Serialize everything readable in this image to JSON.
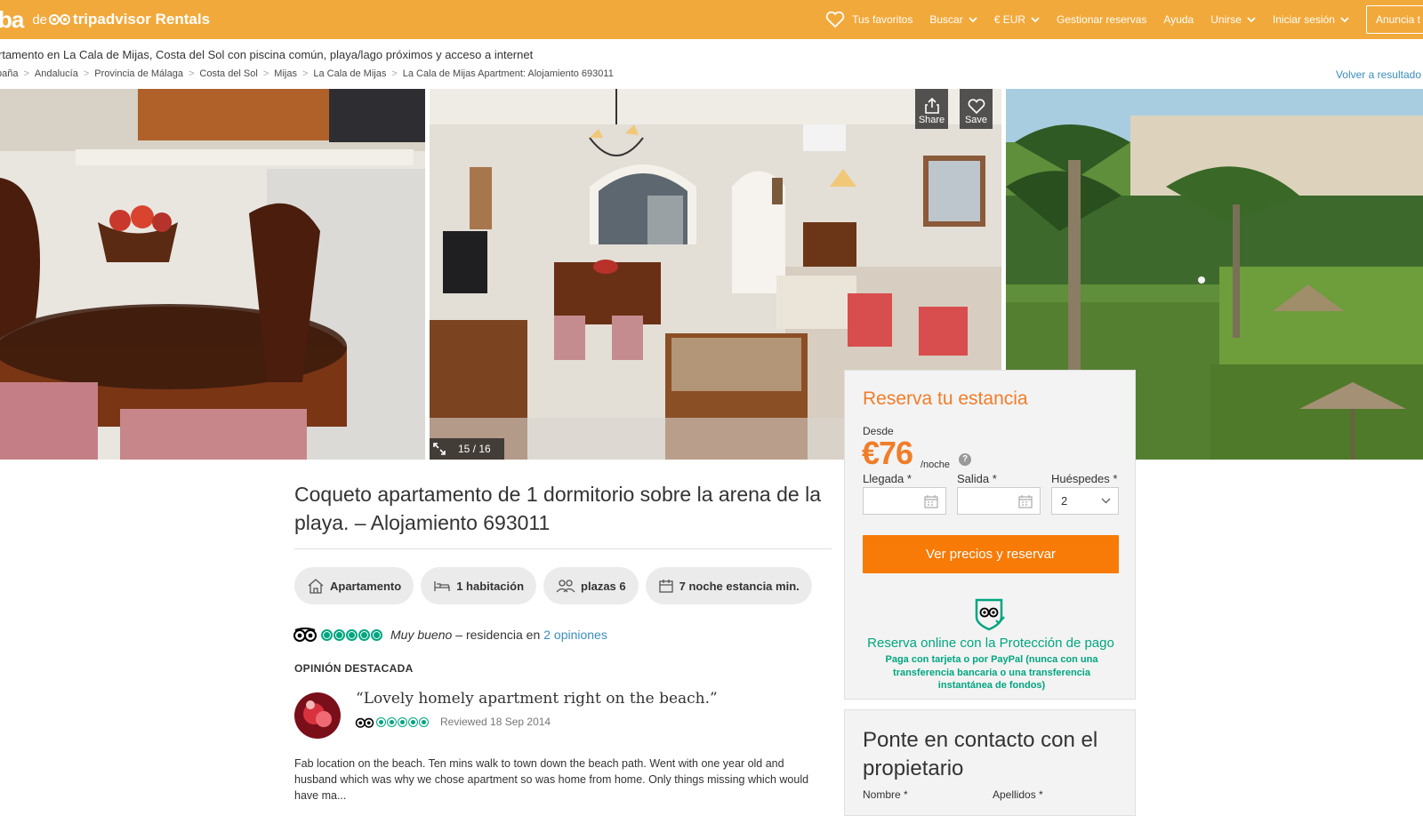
{
  "brand": {
    "prefix": "ba",
    "de": "de",
    "name": "tripadvisor Rentals"
  },
  "nav": {
    "favorites": "Tus favoritos",
    "search": "Buscar",
    "currency": "€ EUR",
    "manage": "Gestionar reservas",
    "help": "Ayuda",
    "join": "Unirse",
    "login": "Iniciar sesión",
    "advertise": "Anuncia t"
  },
  "subtitle": "rtamento en La Cala de Mijas, Costa del Sol con piscina común, playa/lago próximos y acceso a internet",
  "breadcrumb": [
    "paña",
    "Andalucía",
    "Provincia de Málaga",
    "Costa del Sol",
    "Mijas",
    "La Cala de Mijas",
    "La Cala de Mijas Apartment: Alojamiento 693011"
  ],
  "back_link": "Volver a resultado",
  "photos": {
    "share": "Share",
    "save": "Save",
    "counter": "15 / 16"
  },
  "listing": {
    "title": "Coqueto apartamento de 1 dormitorio sobre la arena de la playa. – Alojamiento 693011",
    "pills": [
      "Apartamento",
      "1 habitación",
      "plazas 6",
      "7 noche estancia min."
    ],
    "rating_value": 5,
    "rating_word": "Muy bueno",
    "rating_mid": "– residencia en",
    "reviews_link": "2 opiniones",
    "featured_heading": "OPINIÓN DESTACADA"
  },
  "review": {
    "title": "“Lovely homely apartment right on the beach.”",
    "rating_value": 5,
    "date": "Reviewed 18 Sep 2014",
    "body": "Fab location on the beach. Ten mins walk to town down the beach path. Went with one year old and husband which was why we chose apartment so was home from home. Only things missing which would have ma..."
  },
  "booking": {
    "title": "Reserva tu estancia",
    "from_label": "Desde",
    "price": "€76",
    "per_night": "/noche",
    "help": "?",
    "checkin_label": "Llegada",
    "checkout_label": "Salida",
    "guests_label": "Huéspedes",
    "required_mark": "*",
    "checkin_value": "",
    "checkout_value": "",
    "guests_value": "2",
    "cta": "Ver precios y reservar",
    "protect_title": "Reserva online con la Protección de pago",
    "protect_text": "Paga con tarjeta o por PayPal (nunca con una transferencia bancaria o una transferencia instantánea de fondos)"
  },
  "contact": {
    "title": "Ponte en contacto con el propietario",
    "first_name_label": "Nombre",
    "last_name_label": "Apellidos",
    "required_mark": "*"
  },
  "colors": {
    "brand_orange": "#f2a93b",
    "cta_orange": "#f77b06",
    "price_orange": "#f07d28",
    "tripadvisor_green": "#00a680",
    "link_blue": "#3b8dbd"
  }
}
